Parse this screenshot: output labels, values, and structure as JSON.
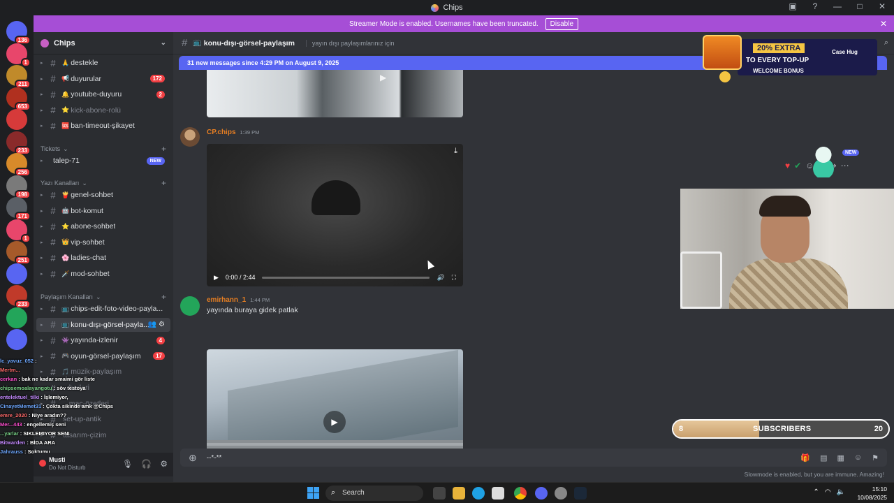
{
  "window": {
    "title": "Chips"
  },
  "banner": {
    "text": "Streamer Mode is enabled. Usernames have been truncated.",
    "disable_label": "Disable",
    "close": "✕"
  },
  "servers": [
    {
      "badge": "136",
      "color": "#5865f2"
    },
    {
      "badge": "1",
      "color": "#e8466b"
    },
    {
      "badge": "211",
      "color": "#c08a2a"
    },
    {
      "badge": "653",
      "color": "#b0301f"
    },
    {
      "badge": "",
      "color": "#d63a3a"
    },
    {
      "badge": "233",
      "color": "#8a2a2a"
    },
    {
      "badge": "256",
      "color": "#d88a2a"
    },
    {
      "badge": "198",
      "color": "#7a7a7a"
    },
    {
      "badge": "171",
      "color": "#5a5f66"
    },
    {
      "badge": "1",
      "color": "#e8466b"
    },
    {
      "badge": "251",
      "color": "#a65a2a"
    },
    {
      "badge": "",
      "color": "#5865f2"
    },
    {
      "badge": "233",
      "color": "#c03a2a"
    },
    {
      "badge": "",
      "color": "#23a55a"
    },
    {
      "badge": "",
      "color": "#5865f2"
    }
  ],
  "guild": {
    "name": "Chips"
  },
  "channels_top": [
    {
      "emoji": "🙏",
      "name": "destekle",
      "badge": ""
    },
    {
      "emoji": "📢",
      "name": "duyurular",
      "badge": "172"
    },
    {
      "emoji": "🔔",
      "name": "youtube-duyuru",
      "badge": "2"
    },
    {
      "emoji": "⭐",
      "name": "kick-abone-rolü",
      "badge": ""
    },
    {
      "emoji": "🆘",
      "name": "ban-timeout-şikayet",
      "badge": ""
    }
  ],
  "categories": {
    "tickets": "Tickets",
    "text": "Yazı Kanalları",
    "share": "Paylaşım Kanalları"
  },
  "ticket_channel": {
    "name": "talep-71",
    "new_label": "NEW"
  },
  "text_channels": [
    {
      "emoji": "🍟",
      "name": "genel-sohbet"
    },
    {
      "emoji": "🤖",
      "name": "bot-komut"
    },
    {
      "emoji": "⭐",
      "name": "abone-sohbet"
    },
    {
      "emoji": "👑",
      "name": "vip-sohbet"
    },
    {
      "emoji": "🌸",
      "name": "ladies-chat"
    },
    {
      "emoji": "🗡️",
      "name": "mod-sohbet"
    }
  ],
  "share_channels": [
    {
      "emoji": "📺",
      "name": "chips-edit-foto-video-payla...",
      "badge": ""
    },
    {
      "emoji": "📺",
      "name": "konu-dışı-görsel-payla...",
      "badge": ""
    },
    {
      "emoji": "👾",
      "name": "yayında-izlenir",
      "badge": "4"
    },
    {
      "emoji": "🎮",
      "name": "oyun-görsel-paylaşım",
      "badge": "17"
    },
    {
      "emoji": "🎵",
      "name": "müzik-paylaşım",
      "badge": ""
    },
    {
      "emoji": "",
      "name": "...berleri",
      "badge": ""
    },
    {
      "emoji": "",
      "name": "...maç-özetleri",
      "badge": ""
    },
    {
      "emoji": "",
      "name": "set-up-antik",
      "badge": ""
    },
    {
      "emoji": "",
      "name": "tasarım-çizim",
      "badge": ""
    }
  ],
  "chat_overlay": [
    {
      "user": "lc_yavuz_052",
      "text": ":"
    },
    {
      "user": "Mertm...",
      "text": ""
    },
    {
      "user": "cerkan",
      "text": ": bak ne kadar smaimi gör liste"
    },
    {
      "user": "chipsemoalayangotu",
      "text": ": söv testoya"
    },
    {
      "user": "entelektuel_tilki",
      "text": ": İşlemiyor,"
    },
    {
      "user": "CinayetMemet31",
      "text": ": Çokta sikinde amk @Chips"
    },
    {
      "user": "emre_2020",
      "text": ": Niye aradın??"
    },
    {
      "user": "Mer...443",
      "text": ": engellemiş seni"
    },
    {
      "user": "...yarlar",
      "text": ": SIKLEMIYOR SENI"
    },
    {
      "user": "Bitwarden",
      "text": ": BİDA ARA"
    },
    {
      "user": "Jahrauss",
      "text": ": Soktumu"
    }
  ],
  "user": {
    "name": "Musti",
    "status": "Do Not Disturb"
  },
  "header": {
    "channel_name": "konu-dışı-görsel-paylaşım",
    "channel_emoji": "📺",
    "topic": "yayın dışı paylaşımlarınız için"
  },
  "new_messages_bar": "31 new messages since 4:29 PM on August 9, 2025",
  "ad": {
    "percent": "20% EXTRA",
    "line": "TO EVERY TOP-UP",
    "bonus": "WELCOME BONUS",
    "brand": "Case Hug"
  },
  "messages": [
    {
      "author": "CP.chips",
      "time": "1:39 PM",
      "author_color": "#e67e22",
      "video": {
        "time": "0:00 / 2:44"
      }
    },
    {
      "author": "emirhann_1",
      "time": "1:44 PM",
      "author_color": "#e67e22",
      "text": "yayında buraya gidek patlak"
    }
  ],
  "composer": {
    "value": "--*-**"
  },
  "slowmode": "Slowmode is enabled, but you are immune. Amazing!",
  "subscribers": {
    "label": "SUBSCRIBERS",
    "current": "8",
    "goal": "20",
    "progress": 0.4
  },
  "taskbar": {
    "search": "Search",
    "time": "15:10",
    "date": "10/08/2025"
  },
  "colors": {
    "accent": "#5865f2",
    "banner": "#a64ed6",
    "badge": "#f23f43"
  }
}
